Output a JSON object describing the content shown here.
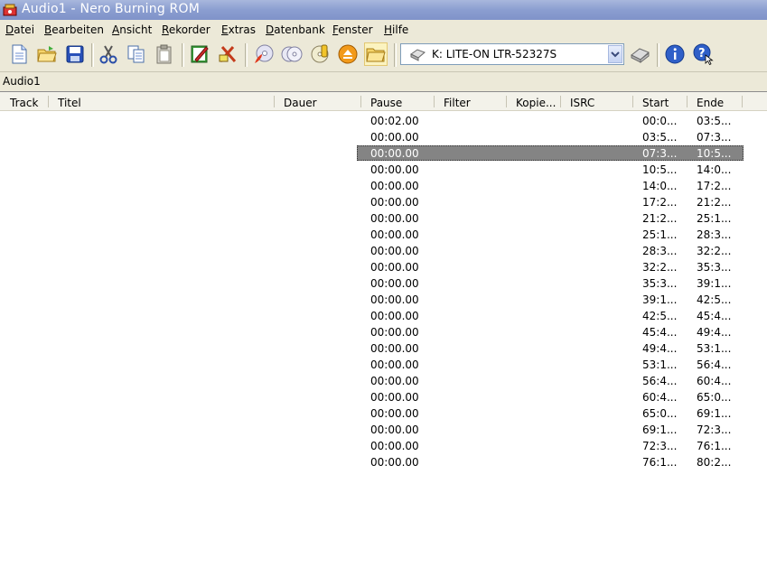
{
  "window": {
    "title": "Audio1 - Nero Burning ROM"
  },
  "menu": [
    "Datei",
    "Bearbeiten",
    "Ansicht",
    "Rekorder",
    "Extras",
    "Datenbank",
    "Fenster",
    "Hilfe"
  ],
  "recorder": {
    "selected": "K: LITE-ON  LTR-52327S"
  },
  "document": {
    "label": "Audio1"
  },
  "columns": [
    "Track",
    "Titel",
    "Dauer",
    "Pause",
    "Filter",
    "Kopie...",
    "ISRC",
    "Start",
    "Ende"
  ],
  "rows": [
    {
      "pause": "00:02.00",
      "start": "00:0...",
      "ende": "03:5..."
    },
    {
      "pause": "00:00.00",
      "start": "03:5...",
      "ende": "07:3..."
    },
    {
      "pause": "00:00.00",
      "start": "07:3...",
      "ende": "10:5...",
      "selected": true
    },
    {
      "pause": "00:00.00",
      "start": "10:5...",
      "ende": "14:0..."
    },
    {
      "pause": "00:00.00",
      "start": "14:0...",
      "ende": "17:2..."
    },
    {
      "pause": "00:00.00",
      "start": "17:2...",
      "ende": "21:2..."
    },
    {
      "pause": "00:00.00",
      "start": "21:2...",
      "ende": "25:1..."
    },
    {
      "pause": "00:00.00",
      "start": "25:1...",
      "ende": "28:3..."
    },
    {
      "pause": "00:00.00",
      "start": "28:3...",
      "ende": "32:2..."
    },
    {
      "pause": "00:00.00",
      "start": "32:2...",
      "ende": "35:3..."
    },
    {
      "pause": "00:00.00",
      "start": "35:3...",
      "ende": "39:1..."
    },
    {
      "pause": "00:00.00",
      "start": "39:1...",
      "ende": "42:5..."
    },
    {
      "pause": "00:00.00",
      "start": "42:5...",
      "ende": "45:4..."
    },
    {
      "pause": "00:00.00",
      "start": "45:4...",
      "ende": "49:4..."
    },
    {
      "pause": "00:00.00",
      "start": "49:4...",
      "ende": "53:1..."
    },
    {
      "pause": "00:00.00",
      "start": "53:1...",
      "ende": "56:4..."
    },
    {
      "pause": "00:00.00",
      "start": "56:4...",
      "ende": "60:4..."
    },
    {
      "pause": "00:00.00",
      "start": "60:4...",
      "ende": "65:0..."
    },
    {
      "pause": "00:00.00",
      "start": "65:0...",
      "ende": "69:1..."
    },
    {
      "pause": "00:00.00",
      "start": "69:1...",
      "ende": "72:3..."
    },
    {
      "pause": "00:00.00",
      "start": "72:3...",
      "ende": "76:1..."
    },
    {
      "pause": "00:00.00",
      "start": "76:1...",
      "ende": "80:2..."
    }
  ]
}
